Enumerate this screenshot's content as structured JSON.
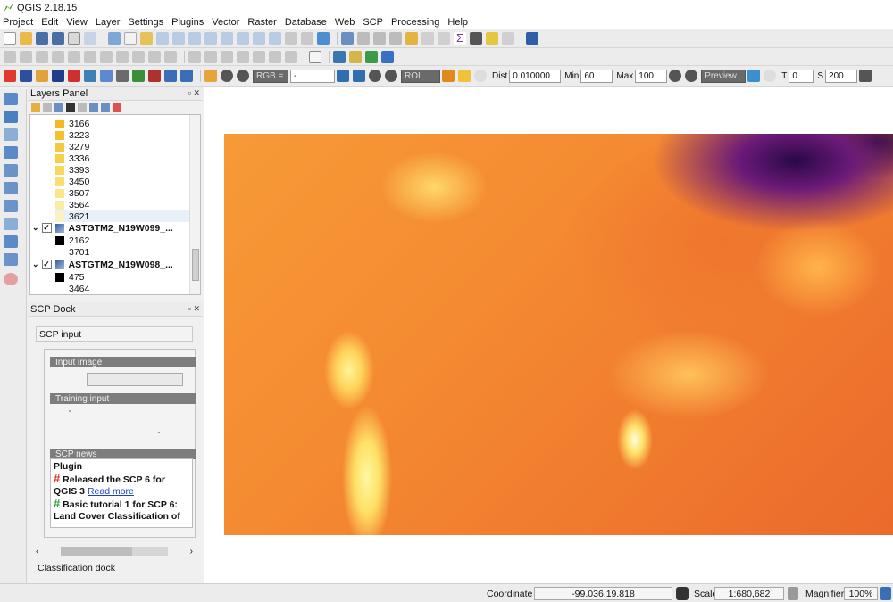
{
  "title": "QGIS 2.18.15",
  "menu": [
    "Project",
    "Edit",
    "View",
    "Layer",
    "Settings",
    "Plugins",
    "Vector",
    "Raster",
    "Database",
    "Web",
    "SCP",
    "Processing",
    "Help"
  ],
  "scp_toolbar": {
    "band_set": "RGB =",
    "band_value": "-",
    "roi_label": "ROI",
    "dist_label": "Dist",
    "dist_value": "0.010000",
    "min_label": "Min",
    "min_value": "60",
    "max_label": "Max",
    "max_value": "100",
    "preview_label": "Preview",
    "t_label": "T",
    "t_value": "0",
    "s_label": "S",
    "s_value": "200"
  },
  "layers_panel": {
    "title": "Layers Panel",
    "rows": [
      {
        "label": "3166",
        "color": "#f4b726"
      },
      {
        "label": "3223",
        "color": "#f5c030"
      },
      {
        "label": "3279",
        "color": "#f6c93c"
      },
      {
        "label": "3336",
        "color": "#f7d04a"
      },
      {
        "label": "3393",
        "color": "#f8d75c"
      },
      {
        "label": "3450",
        "color": "#f9de72"
      },
      {
        "label": "3507",
        "color": "#fae58a"
      },
      {
        "label": "3564",
        "color": "#fbeca4"
      },
      {
        "label": "3621",
        "color": "#fcf2c0"
      },
      {
        "label": "ASTGTM2_N19W099_...",
        "color": "",
        "group": true
      },
      {
        "label": "2162",
        "color": "#000000"
      },
      {
        "label": "3701",
        "color": ""
      },
      {
        "label": "ASTGTM2_N19W098_...",
        "color": "",
        "group": true
      },
      {
        "label": "475",
        "color": "#000000"
      },
      {
        "label": "3464",
        "color": ""
      }
    ]
  },
  "scp_dock": {
    "title": "SCP Dock",
    "scp_input": "SCP input",
    "input_image": "Input image",
    "training_input": "Training input",
    "scp_news": "SCP news",
    "news_heading": "Plugin",
    "news1": "Released the SCP 6 for QGIS 3",
    "news1_link": "Read more",
    "news2": "Basic tutorial 1 for SCP 6: Land Cover Classification of",
    "classification_dock": "Classification dock"
  },
  "statusbar": {
    "coordinate_label": "Coordinate",
    "coordinate_value": "-99.036,19.818",
    "scale_label": "Scale",
    "scale_value": "1:680,682",
    "magnifier_label": "Magnifier",
    "magnifier_value": "100%"
  }
}
